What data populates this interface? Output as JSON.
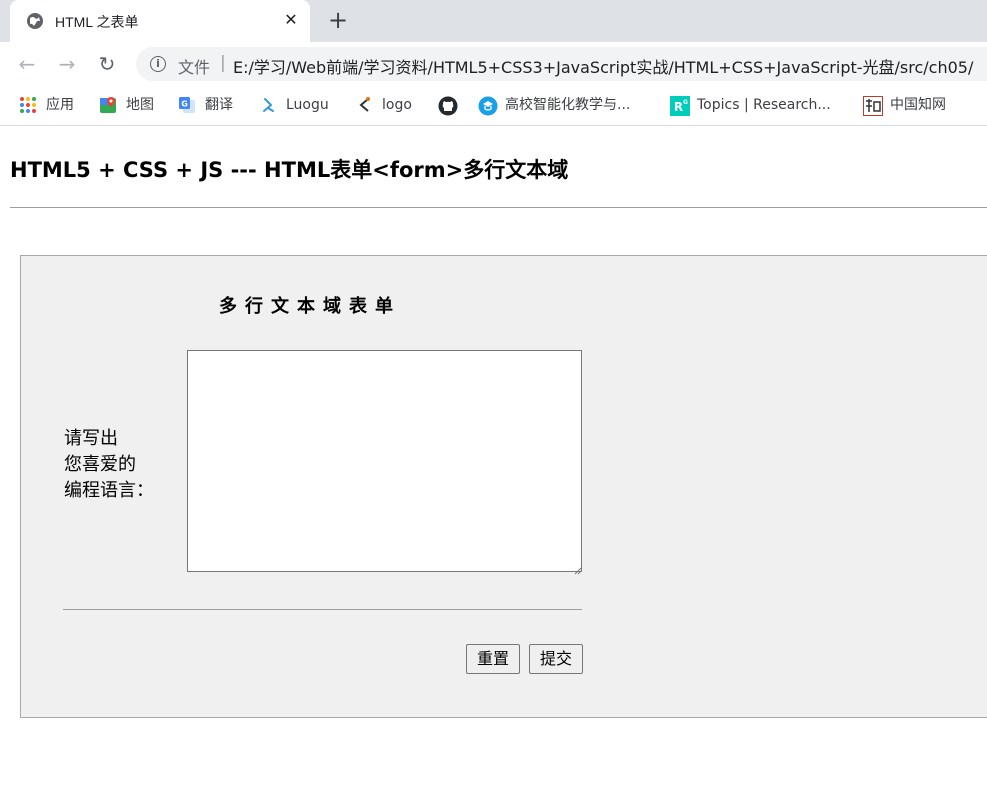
{
  "browser": {
    "tab": {
      "title": "HTML 之表单",
      "close_glyph": "✕",
      "favicon": "globe-icon"
    },
    "new_tab_glyph": "+",
    "nav": {
      "back": "←",
      "forward": "→",
      "reload": "↻"
    },
    "omnibox": {
      "info_glyph": "i",
      "scheme_label": "文件",
      "separator": "|",
      "url": "E:/学习/Web前端/学习资料/HTML5+CSS3+JavaScript实战/HTML+CSS+JavaScript-光盘/src/ch05/"
    },
    "bookmarks": [
      {
        "label": "应用",
        "icon": "apps-grid-icon"
      },
      {
        "label": "地图",
        "icon": "maps-icon"
      },
      {
        "label": "翻译",
        "icon": "translate-icon"
      },
      {
        "label": "Luogu",
        "icon": "luogu-icon"
      },
      {
        "label": "logo",
        "icon": "logo-icon"
      },
      {
        "label": "",
        "icon": "github-icon"
      },
      {
        "label": "高校智能化教学与...",
        "icon": "education-icon"
      },
      {
        "label": "Topics | Research...",
        "icon": "researchgate-icon"
      },
      {
        "label": "中国知网",
        "icon": "cnki-icon"
      }
    ]
  },
  "page": {
    "title": "HTML5 + CSS + JS --- HTML表单<form>多行文本域",
    "form": {
      "heading": "多行文本域表单",
      "label_lines": [
        "请写出",
        "您喜爱的",
        "编程语言："
      ],
      "textarea_value": "",
      "reset_label": "重置",
      "submit_label": "提交"
    }
  },
  "colors": {
    "tabstrip_bg": "#dee1e6",
    "omnibox_bg": "#f1f3f4",
    "panel_bg": "#f0f0f0",
    "panel_border": "#a9a9a9"
  }
}
